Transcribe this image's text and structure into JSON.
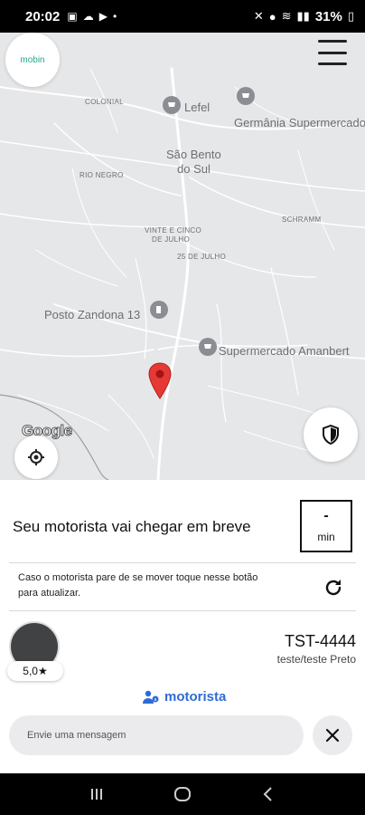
{
  "status_bar": {
    "time": "20:02",
    "battery": "31%"
  },
  "map": {
    "logo_text": "mobin",
    "labels": {
      "colonial": "COLONIAL",
      "lefel": "Lefel",
      "germania": "Germânia Supermercado",
      "sao_bento_1": "São Bento",
      "sao_bento_2": "do Sul",
      "rio_negro": "RIO NEGRO",
      "schramm": "SCHRAMM",
      "vinte_cinco_1": "VINTE E CINCO",
      "vinte_cinco_2": "DE JULHO",
      "vinte_cinco_b": "25 DE JULHO",
      "posto": "Posto Zandona 13",
      "supermercado": "Supermercado Amanbert",
      "google": "Google"
    }
  },
  "arrival": {
    "title": "Seu motorista vai chegar em breve",
    "eta_value": "-",
    "eta_unit": "min"
  },
  "refresh": {
    "text": "Caso o motorista pare de se mover toque nesse botão para atualizar."
  },
  "driver": {
    "rating": "5,0★",
    "plate": "TST-4444",
    "vehicle": "teste/teste Preto",
    "link_label": "motorista"
  },
  "message": {
    "placeholder": "Envie uma mensagem"
  },
  "colors": {
    "accent_blue": "#2f6bd6",
    "pin_red": "#e53935",
    "map_bg": "#e6e7e9"
  }
}
